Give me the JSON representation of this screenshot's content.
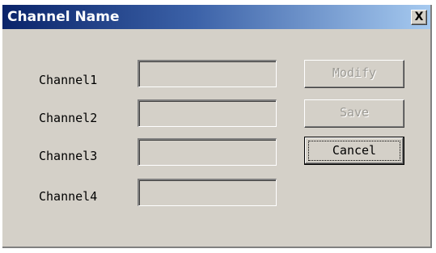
{
  "window": {
    "title": "Channel Name",
    "close_glyph": "X"
  },
  "channels": [
    {
      "label": "Channel1",
      "value": ""
    },
    {
      "label": "Channel2",
      "value": ""
    },
    {
      "label": "Channel3",
      "value": ""
    },
    {
      "label": "Channel4",
      "value": ""
    }
  ],
  "buttons": {
    "modify": "Modify",
    "save": "Save",
    "cancel": "Cancel"
  },
  "colors": {
    "dialog_face": "#d4d0c8",
    "title_start": "#0a246a",
    "title_end": "#a6caf0",
    "disabled_text": "#9c9a94"
  },
  "icons": {
    "close": "close-icon"
  }
}
